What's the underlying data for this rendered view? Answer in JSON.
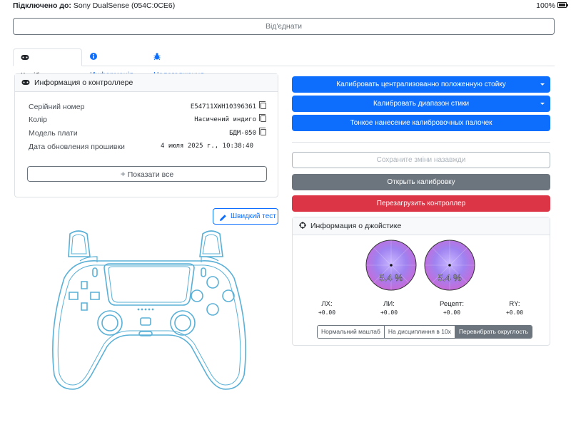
{
  "status": {
    "connected_label": "Підключено до:",
    "device_name": "Sony DualSense (054C:0CE6)",
    "battery_text": "100%",
    "battery_level": 1.0
  },
  "disconnect_label": "Від'єднати",
  "tabs": [
    {
      "label": "Калібрування",
      "icon": "gamepad-icon"
    },
    {
      "label": "Информація",
      "icon": "info-icon"
    },
    {
      "label": "Налагодження",
      "icon": "bug-icon"
    }
  ],
  "controller_info": {
    "title": "Информация о контроллере",
    "rows": [
      {
        "key": "Серійний номер",
        "value": "E54711XWH10396361"
      },
      {
        "key": "Колір",
        "value": "Насичений индиго"
      },
      {
        "key": "Модель плати",
        "value": "БДМ-050"
      },
      {
        "key": "Дата обновления прошивки",
        "value": "4 июля 2025 г., 10:38:40"
      }
    ],
    "show_all_label": "Показати все"
  },
  "quick_test_label": "Швидкий тест",
  "actions": {
    "calibrate_center": "Калибровать централизованно положенную стойку",
    "calibrate_range": "Калибровать диапазон стики",
    "fine_tune": "Тонкое нанесение калибровочных палочек",
    "save": "Сохраните зміни назавжди",
    "open_calibration": "Открыть калибровку",
    "reboot": "Перезагрузить контроллер"
  },
  "joystick": {
    "title": "Информация о джойстике",
    "left_percent": "5.4 %",
    "right_percent": "5.4 %",
    "axes": [
      {
        "label": "ЛХ:",
        "value": "+0.00"
      },
      {
        "label": "ЛИ:",
        "value": "+0.00"
      },
      {
        "label": "Рецепт:",
        "value": "+0.00"
      },
      {
        "label": "RY:",
        "value": "+0.00"
      }
    ],
    "modes": [
      "Нормальний маштаб",
      "На дисциплиння в 10х",
      "Перевибрать округлость"
    ]
  },
  "colors": {
    "primary": "#0d6efd",
    "secondary": "#6c757d",
    "danger": "#dc3545",
    "controller_outline": "#5ab0d6"
  }
}
